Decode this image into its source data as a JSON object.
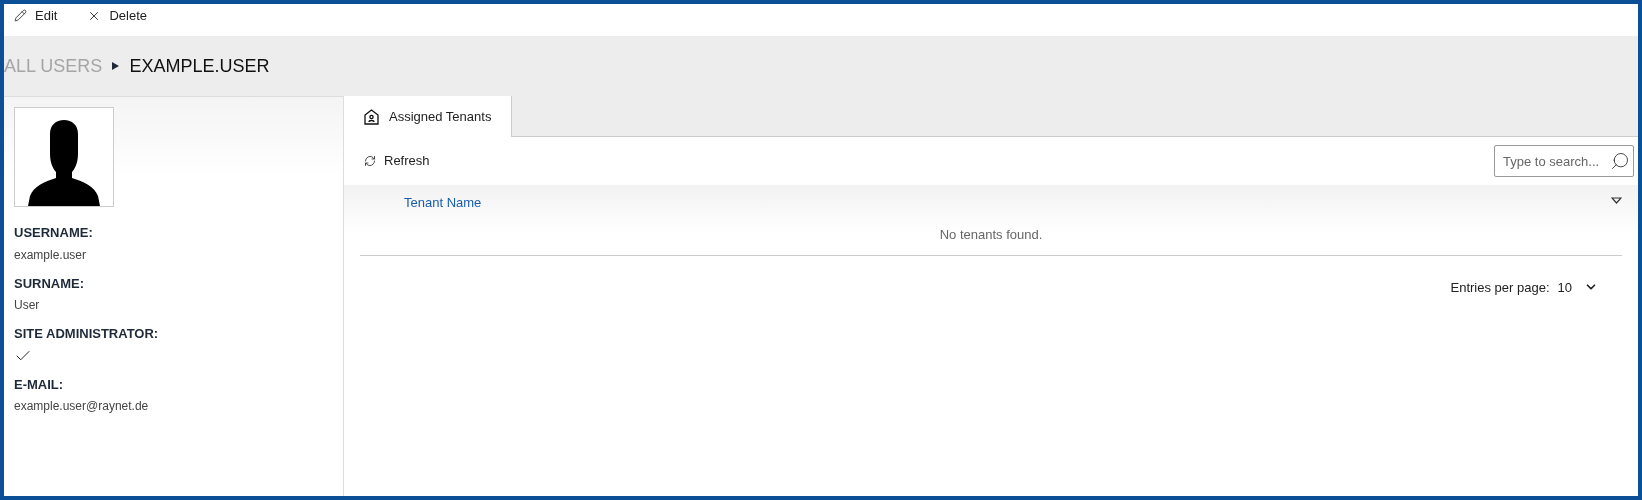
{
  "toolbar": [
    {
      "kind": "edit",
      "label": "Edit"
    },
    {
      "kind": "delete",
      "label": "Delete"
    }
  ],
  "breadcrumb": {
    "parent": "ALL USERS",
    "current": "EXAMPLE.USER"
  },
  "profile": {
    "fields": [
      {
        "kind": "text",
        "label": "USERNAME:",
        "value": "example.user"
      },
      {
        "kind": "text",
        "label": "SURNAME:",
        "value": "User"
      },
      {
        "kind": "check",
        "label": "SITE ADMINISTRATOR:",
        "checked": true
      },
      {
        "kind": "text",
        "label": "E-MAIL:",
        "value": "example.user@raynet.de"
      }
    ]
  },
  "tabs": [
    {
      "label": "Assigned Tenants",
      "selected": true
    }
  ],
  "refresh": "Refresh",
  "search": {
    "placeholder": "Type to search..."
  },
  "table": {
    "columns": [
      "Tenant Name"
    ],
    "empty": "No tenants found."
  },
  "pagination": {
    "label": "Entries per page:",
    "value": "10"
  }
}
